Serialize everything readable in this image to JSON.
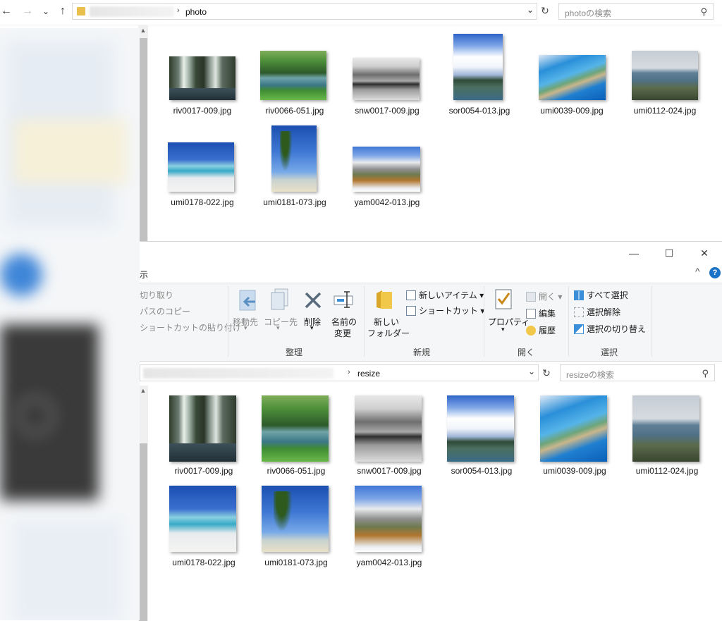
{
  "top_window": {
    "address": {
      "crumb": "photo"
    },
    "search": {
      "placeholder": "photoの検索"
    },
    "files": [
      {
        "name": "riv0017-009.jpg",
        "palette": "p-fall"
      },
      {
        "name": "riv0066-051.jpg",
        "palette": "p-lake"
      },
      {
        "name": "snw0017-009.jpg",
        "palette": "p-snow"
      },
      {
        "name": "sor0054-013.jpg",
        "palette": "p-sky"
      },
      {
        "name": "umi0039-009.jpg",
        "palette": "p-bay"
      },
      {
        "name": "umi0112-024.jpg",
        "palette": "p-coast"
      },
      {
        "name": "umi0178-022.jpg",
        "palette": "p-beach"
      },
      {
        "name": "umi0181-073.jpg",
        "palette": "p-palm"
      },
      {
        "name": "yam0042-013.jpg",
        "palette": "p-mtn"
      }
    ]
  },
  "bottom_window": {
    "tab_partial": "示",
    "ribbon": {
      "clipboard": {
        "cut": "切り取り",
        "copy_path": "パスのコピー",
        "paste_shortcut": "ショートカットの貼り付け"
      },
      "organize": {
        "label": "整理",
        "move_to": "移動先",
        "copy_to": "コピー先",
        "delete": "削除",
        "rename_line1": "名前の",
        "rename_line2": "変更"
      },
      "new": {
        "label": "新規",
        "new_folder_line1": "新しい",
        "new_folder_line2": "フォルダー",
        "new_item": "新しいアイテム",
        "shortcut": "ショートカット"
      },
      "open": {
        "label": "開く",
        "properties": "プロパティ",
        "open": "開く",
        "edit": "編集",
        "history": "履歴"
      },
      "select": {
        "label": "選択",
        "select_all": "すべて選択",
        "select_none": "選択解除",
        "invert": "選択の切り替え"
      }
    },
    "address": {
      "crumb": "resize"
    },
    "search": {
      "placeholder": "resizeの検索"
    },
    "files": [
      {
        "name": "riv0017-009.jpg",
        "palette": "p-fall"
      },
      {
        "name": "riv0066-051.jpg",
        "palette": "p-lake"
      },
      {
        "name": "snw0017-009.jpg",
        "palette": "p-snow"
      },
      {
        "name": "sor0054-013.jpg",
        "palette": "p-sky"
      },
      {
        "name": "umi0039-009.jpg",
        "palette": "p-bay"
      },
      {
        "name": "umi0112-024.jpg",
        "palette": "p-coast"
      },
      {
        "name": "umi0178-022.jpg",
        "palette": "p-beach"
      },
      {
        "name": "umi0181-073.jpg",
        "palette": "p-palm"
      },
      {
        "name": "yam0042-013.jpg",
        "palette": "p-mtn"
      }
    ]
  },
  "colors": {
    "folder": "#e9c04d",
    "help": "#1a73c8",
    "select_blue": "#3a8fd8"
  },
  "icons": {
    "back": "←",
    "forward": "→",
    "recent": "⌄",
    "up": "↑",
    "refresh": "↻",
    "search": "⚲",
    "dropdown": "⌄",
    "chevron": "›",
    "minimize": "—",
    "maximize": "☐",
    "close": "✕",
    "collapse": "^",
    "help": "?"
  }
}
